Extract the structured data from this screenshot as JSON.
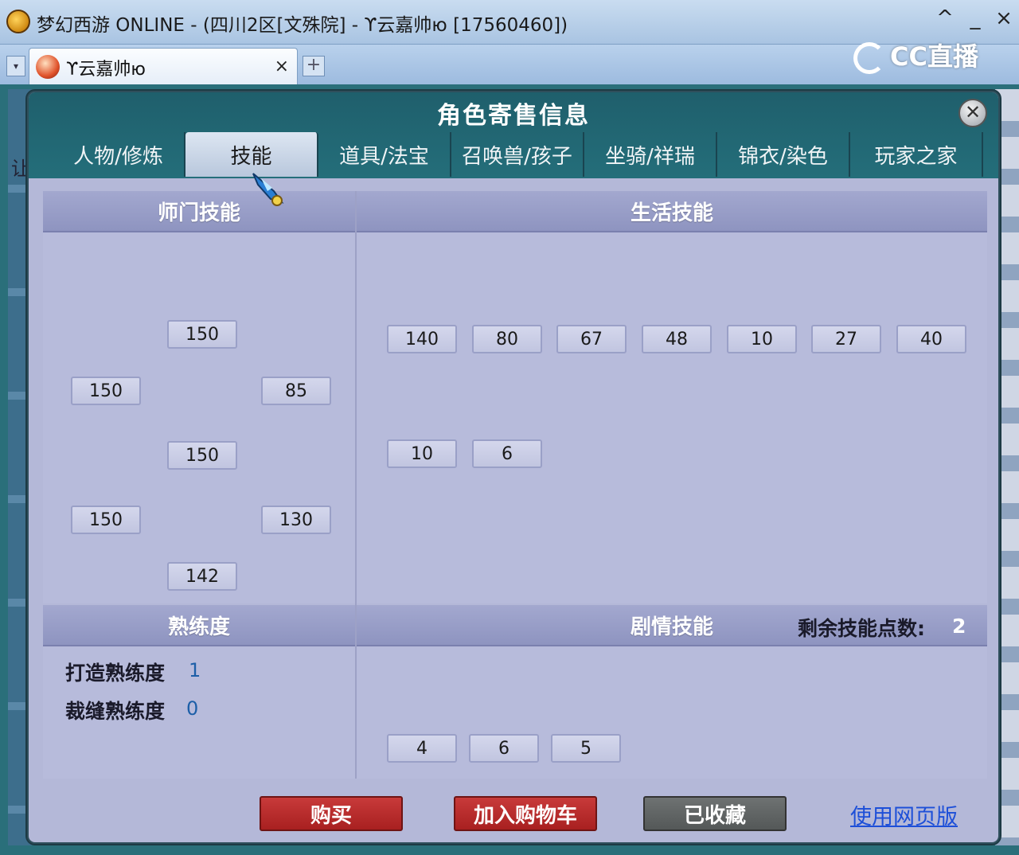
{
  "window": {
    "title": "梦幻西游 ONLINE - (四川2区[文殊院] - ϒ云嘉帅ю [17560460])",
    "controls": [
      "^",
      "_",
      "×"
    ]
  },
  "browser_tab": {
    "label": "ϒ云嘉帅ю",
    "close": "×",
    "add": "+"
  },
  "watermark": "CC直播",
  "background_text": "让",
  "panel": {
    "title": "角色寄售信息",
    "close": "✕",
    "tabs": [
      "人物/修炼",
      "技能",
      "道具/法宝",
      "召唤兽/孩子",
      "坐骑/祥瑞",
      "锦衣/染色",
      "玩家之家"
    ],
    "active_tab": "技能"
  },
  "sections": {
    "school_skills": {
      "title": "师门技能",
      "values": [
        "150",
        "150",
        "85",
        "150",
        "150",
        "130",
        "142"
      ]
    },
    "life_skills": {
      "title": "生活技能",
      "values": [
        "140",
        "80",
        "67",
        "48",
        "10",
        "27",
        "40",
        "10",
        "6"
      ]
    },
    "proficiency": {
      "title": "熟练度",
      "items": [
        {
          "label": "打造熟练度",
          "value": "1"
        },
        {
          "label": "裁缝熟练度",
          "value": "0"
        }
      ]
    },
    "story_skills": {
      "title": "剧情技能",
      "points_label": "剩余技能点数:",
      "points_value": "2",
      "values": [
        "4",
        "6",
        "5"
      ]
    }
  },
  "actions": {
    "buy": "购买",
    "add_to_cart": "加入购物车",
    "favorited": "已收藏",
    "web_version": "使用网页版"
  },
  "colors": {
    "accent_red": "#b42a2a",
    "link_blue": "#1d4fd8",
    "panel_teal": "#246e7a"
  }
}
